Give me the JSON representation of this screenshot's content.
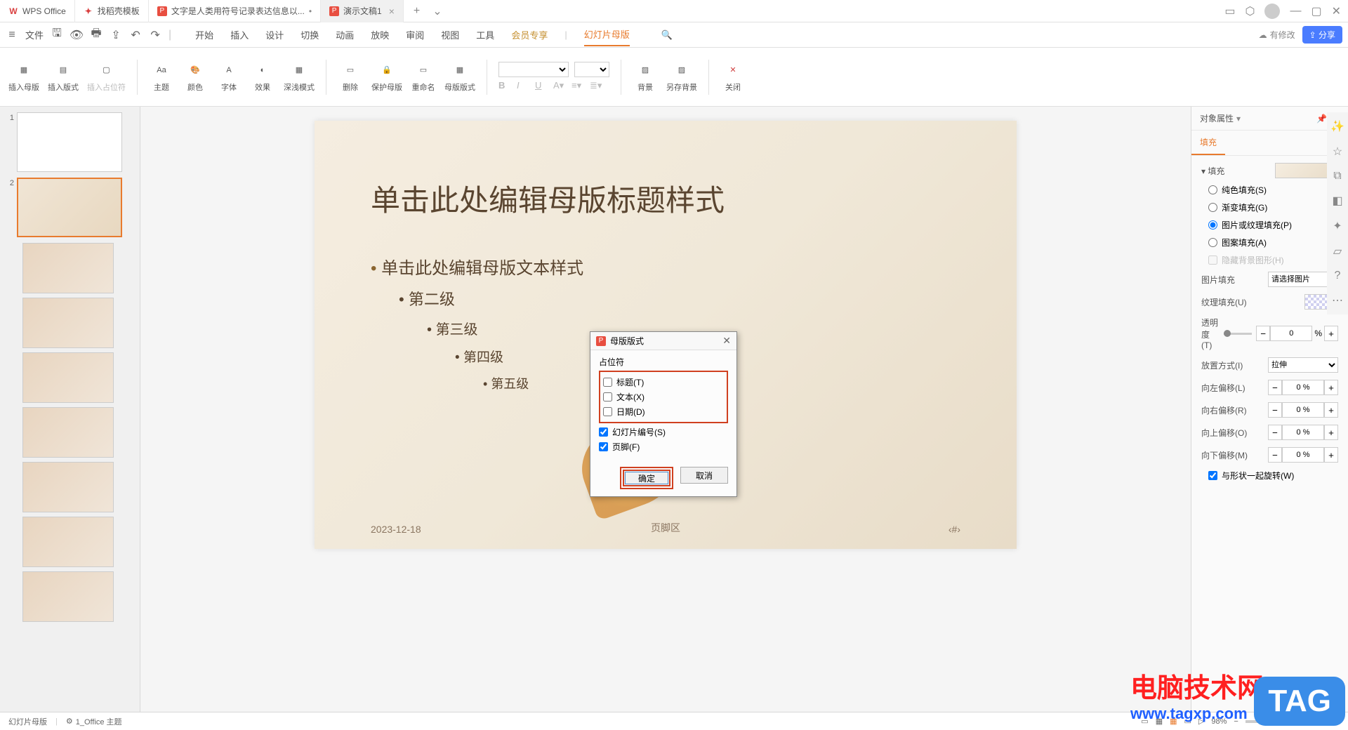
{
  "titlebar": {
    "tabs": [
      {
        "icon": "W",
        "label": "WPS Office"
      },
      {
        "icon": "W",
        "label": "找稻壳模板"
      },
      {
        "icon": "P",
        "label": "文字是人类用符号记录表达信息以..."
      },
      {
        "icon": "P",
        "label": "演示文稿1"
      }
    ]
  },
  "menubar": {
    "file": "文件",
    "tabs": [
      "开始",
      "插入",
      "设计",
      "切换",
      "动画",
      "放映",
      "审阅",
      "视图",
      "工具",
      "会员专享",
      "幻灯片母版"
    ],
    "active": "幻灯片母版",
    "cloud": "有修改",
    "share": "分享"
  },
  "ribbon": {
    "btns": {
      "insert_master": "插入母版",
      "insert_layout": "插入版式",
      "insert_placeholder": "插入占位符",
      "theme": "主题",
      "color": "颜色",
      "font": "字体",
      "effect": "效果",
      "depth": "深浅模式",
      "delete": "删除",
      "protect": "保护母版",
      "rename": "重命名",
      "master_layout": "母版版式",
      "bg": "背景",
      "save_bg": "另存背景",
      "close": "关闭"
    }
  },
  "slide": {
    "title": "单击此处编辑母版标题样式",
    "body_l1": "单击此处编辑母版文本样式",
    "body_l2": "第二级",
    "body_l3": "第三级",
    "body_l4": "第四级",
    "body_l5": "第五级",
    "date": "2023-12-18",
    "footer": "页脚区",
    "num": "‹#›"
  },
  "dialog": {
    "title": "母版版式",
    "group": "占位符",
    "checks": {
      "title": "标题(T)",
      "text": "文本(X)",
      "date": "日期(D)",
      "slidenum": "幻灯片编号(S)",
      "footer": "页脚(F)"
    },
    "ok": "确定",
    "cancel": "取消"
  },
  "props": {
    "header": "对象属性",
    "tab_fill": "填充",
    "section_fill": "填充",
    "radio_solid": "纯色填充(S)",
    "radio_gradient": "渐变填充(G)",
    "radio_picture": "图片或纹理填充(P)",
    "radio_pattern": "图案填充(A)",
    "check_hidebg": "隐藏背景图形(H)",
    "pic_fill": "图片填充",
    "pic_fill_val": "请选择图片",
    "texture_fill": "纹理填充(U)",
    "opacity": "透明度(T)",
    "opacity_val": "0",
    "opacity_unit": "%",
    "tile": "放置方式(I)",
    "tile_val": "拉伸",
    "offset_l": "向左偏移(L)",
    "offset_r": "向右偏移(R)",
    "offset_t": "向上偏移(O)",
    "offset_b": "向下偏移(M)",
    "offset_val": "0 %",
    "rotate": "与形状一起旋转(W)"
  },
  "statusbar": {
    "left1": "幻灯片母版",
    "left2": "1_Office 主题",
    "zoom": "98%"
  },
  "watermark": {
    "line1": "电脑技术网",
    "line2": "www.tagxp.com",
    "tag": "TAG"
  }
}
